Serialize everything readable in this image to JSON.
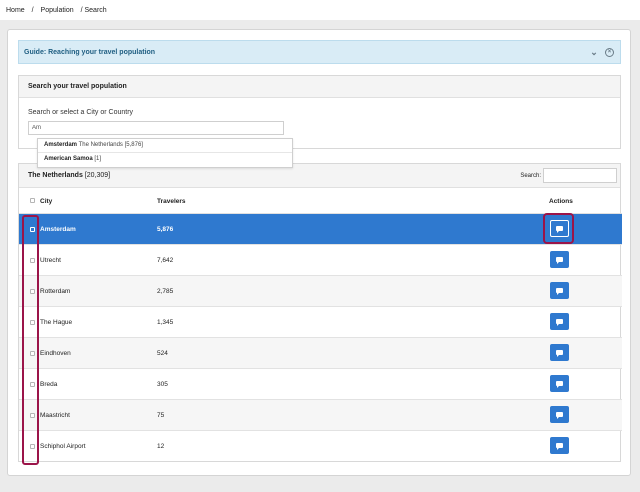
{
  "breadcrumb": [
    {
      "label": "Home"
    },
    {
      "label": "/"
    },
    {
      "label": "Population"
    },
    {
      "label": "/ Search"
    }
  ],
  "guide": {
    "title": "Guide: Reaching your travel population",
    "icons": [
      "chevron-down-icon",
      "close-circle-icon"
    ]
  },
  "search": {
    "heading": "Search your travel population",
    "label": "Search or select a City or Country",
    "value": "Am"
  },
  "dropdown": [
    {
      "city": "Amsterdam",
      "meta": "The Netherlands [5,876]"
    },
    {
      "city": "American Samoa",
      "meta": "[1]"
    }
  ],
  "table": {
    "country": "The Netherlands",
    "total": "[20,309]",
    "search_label": "Search:",
    "columns": {
      "city": "City",
      "travelers": "Travelers",
      "actions": "Actions"
    },
    "rows": [
      {
        "city": "Amsterdam",
        "travelers": "5,876",
        "selected": true
      },
      {
        "city": "Utrecht",
        "travelers": "7,642"
      },
      {
        "city": "Rotterdam",
        "travelers": "2,785"
      },
      {
        "city": "The Hague",
        "travelers": "1,345"
      },
      {
        "city": "Eindhoven",
        "travelers": "524"
      },
      {
        "city": "Breda",
        "travelers": "305"
      },
      {
        "city": "Maastricht",
        "travelers": "75"
      },
      {
        "city": "Schiphol Airport",
        "travelers": "12"
      }
    ]
  },
  "colors": {
    "accent": "#2f79cf",
    "highlight": "#9b1449",
    "guide_bg": "#d9ecf6"
  }
}
